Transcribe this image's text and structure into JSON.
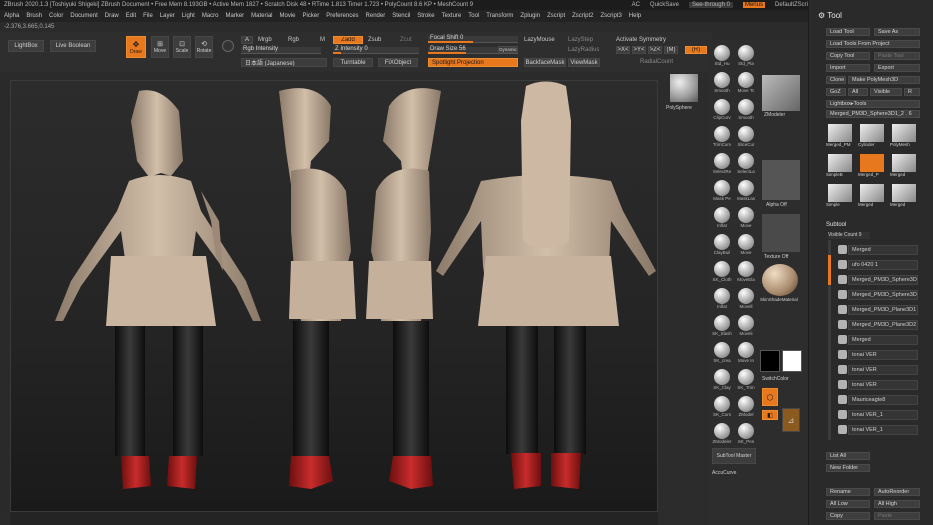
{
  "titlebar": {
    "text": "ZBrush 2020.1.3 [Toshiyuki Shigeki]   ZBrush Document   • Free Mem 8.193GB • Active Mem 1827 • Scratch Disk 48 • RTime 1.813 Timer 1.723 • PolyCount 8.6 KP • MeshCount 9",
    "ac": "AC",
    "quicksave": "QuickSave",
    "seethrough": "See-through  0",
    "menus": "Menus",
    "script": "DefaultZScript"
  },
  "menubar": {
    "items": [
      "Alpha",
      "Brush",
      "Color",
      "Document",
      "Draw",
      "Edit",
      "File",
      "Layer",
      "Light",
      "Macro",
      "Marker",
      "Material",
      "Movie",
      "Picker",
      "Preferences",
      "Render",
      "Stencil",
      "Stroke",
      "Texture",
      "Tool",
      "Transform",
      "Zplugin",
      "Zscript",
      "Zscript2",
      "Zscript3",
      "Help"
    ]
  },
  "coords": "-2.376,3.665,0.145",
  "toolbar": {
    "lightbox": "LightBox",
    "live_boolean": "Live Boolean",
    "draw": "Draw",
    "move": "Move",
    "scale": "Scale",
    "rotate": "Rotate",
    "a": "A",
    "mrgb": "Mrgb",
    "rgb": "Rgb",
    "m": "M",
    "zadd": "Zadd",
    "zsub": "Zsub",
    "zcut": "Zcut",
    "rgb_intensity": "Rgb Intensity",
    "z_intensity": "Z Intensity 0",
    "japanese": "日本語 (Japanese)",
    "turntable": "Turntable",
    "fbx": "FiXObject",
    "focal_shift": "Focal Shift 0",
    "draw_size": "Draw Size 56",
    "dynamic": "Dynamic",
    "spotlight": "Spotlight Projection",
    "lazymouse": "LazyMouse",
    "lazystep": "LazyStep",
    "lazyradius": "LazyRadius",
    "backface": "BackfaceMask",
    "viewmask": "ViewMask",
    "activate_symmetry": "Activate Symmetry",
    "x": ">X<",
    "y": ">Y<",
    "z": ">Z<",
    "m2": "(M)",
    "r": "(R)",
    "radial_count": "RadialCount"
  },
  "brushes": [
    {
      "label": "Std_Hu"
    },
    {
      "label": "Std_Pla"
    },
    {
      "label": "Smooth"
    },
    {
      "label": "Move Tc"
    },
    {
      "label": "ClipCurv"
    },
    {
      "label": "Smooth"
    },
    {
      "label": "TrimCurv"
    },
    {
      "label": "SliceCur"
    },
    {
      "label": "SelectRe"
    },
    {
      "label": "SelectLa"
    },
    {
      "label": "Mask Pe"
    },
    {
      "label": "MaskLas"
    },
    {
      "label": "Inflat"
    },
    {
      "label": "Move"
    },
    {
      "label": "ClayBuil"
    },
    {
      "label": "Move"
    },
    {
      "label": "SK_Cloth"
    },
    {
      "label": "MoveEla"
    },
    {
      "label": "Inflat"
    },
    {
      "label": "Movell"
    },
    {
      "label": "SK_Slash"
    },
    {
      "label": "Moveli"
    },
    {
      "label": "SK_crea"
    },
    {
      "label": "Move In"
    },
    {
      "label": "SK_Clay"
    },
    {
      "label": "SK_Trim"
    },
    {
      "label": "SK_Curs"
    },
    {
      "label": "ZModel"
    },
    {
      "label": "ZModeler"
    },
    {
      "label": "SK_Pen"
    }
  ],
  "midpanel": {
    "polysphere": "PolySphere",
    "zmodeler": "ZModeler",
    "alpha_off": "Alpha Off",
    "texture_off": "Texture Off",
    "material": "SkinShadeMaterial",
    "switch_color": "SwitchColor",
    "subtool_master": "SubTool Master",
    "accu_curve": "AccuCurve"
  },
  "tool": {
    "header": "Tool",
    "row1": [
      "Load Tool",
      "Save As"
    ],
    "row2": "Load Tools From Project",
    "row3": [
      "Copy Tool",
      "Paste Tool"
    ],
    "row4": [
      "Import",
      "Export"
    ],
    "row5": [
      "Clone",
      "Make PolyMesh3D"
    ],
    "row6": [
      "GoZ",
      "All",
      "Visible",
      "R"
    ],
    "lightbox_tools": "Lightbox▸Tools",
    "current_tool": "Merged_PM3D_Sphere3D1_2 . 6",
    "thumbs": [
      "Merged_PM",
      "Cylinder",
      "PolyMesh",
      "SimpleB",
      "Merged_P",
      "Merged",
      "Simple",
      "Merged",
      "Merged"
    ],
    "subtool_header": "Subtool",
    "visible_count": "Visible Count 9",
    "subtools": [
      "Merged",
      "ufo 0420 1",
      "Merged_PM3D_Sphere3D4",
      "Merged_PM3D_Sphere3D1",
      "Merged_PM3D_Plane3D1",
      "Merged_PM3D_Plane3D2",
      "Merged",
      "tonai VER",
      "tonai VER",
      "tonai VER",
      "Mauriceagte8",
      "tonai VER_1",
      "tonai VER_1"
    ],
    "list_all": "List All",
    "new_folder": "New Folder",
    "rename": "Rename",
    "autoreorder": "AutoReorder",
    "all_low": "All Low",
    "all_high": "All High",
    "copy": "Copy",
    "paste": "Paste"
  }
}
